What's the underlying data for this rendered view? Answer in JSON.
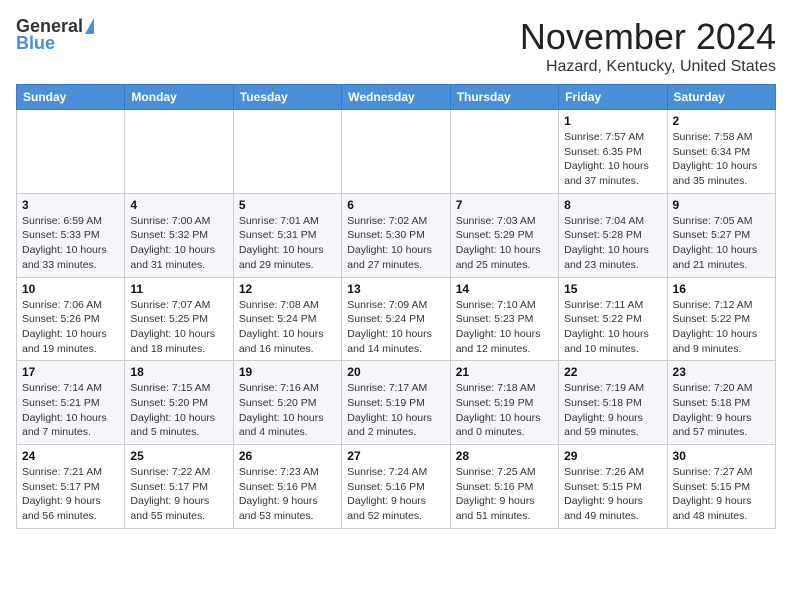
{
  "header": {
    "logo_general": "General",
    "logo_blue": "Blue",
    "month": "November 2024",
    "location": "Hazard, Kentucky, United States"
  },
  "weekdays": [
    "Sunday",
    "Monday",
    "Tuesday",
    "Wednesday",
    "Thursday",
    "Friday",
    "Saturday"
  ],
  "weeks": [
    [
      {
        "day": "",
        "sunrise": "",
        "sunset": "",
        "daylight": ""
      },
      {
        "day": "",
        "sunrise": "",
        "sunset": "",
        "daylight": ""
      },
      {
        "day": "",
        "sunrise": "",
        "sunset": "",
        "daylight": ""
      },
      {
        "day": "",
        "sunrise": "",
        "sunset": "",
        "daylight": ""
      },
      {
        "day": "",
        "sunrise": "",
        "sunset": "",
        "daylight": ""
      },
      {
        "day": "1",
        "sunrise": "Sunrise: 7:57 AM",
        "sunset": "Sunset: 6:35 PM",
        "daylight": "Daylight: 10 hours and 37 minutes."
      },
      {
        "day": "2",
        "sunrise": "Sunrise: 7:58 AM",
        "sunset": "Sunset: 6:34 PM",
        "daylight": "Daylight: 10 hours and 35 minutes."
      }
    ],
    [
      {
        "day": "3",
        "sunrise": "Sunrise: 6:59 AM",
        "sunset": "Sunset: 5:33 PM",
        "daylight": "Daylight: 10 hours and 33 minutes."
      },
      {
        "day": "4",
        "sunrise": "Sunrise: 7:00 AM",
        "sunset": "Sunset: 5:32 PM",
        "daylight": "Daylight: 10 hours and 31 minutes."
      },
      {
        "day": "5",
        "sunrise": "Sunrise: 7:01 AM",
        "sunset": "Sunset: 5:31 PM",
        "daylight": "Daylight: 10 hours and 29 minutes."
      },
      {
        "day": "6",
        "sunrise": "Sunrise: 7:02 AM",
        "sunset": "Sunset: 5:30 PM",
        "daylight": "Daylight: 10 hours and 27 minutes."
      },
      {
        "day": "7",
        "sunrise": "Sunrise: 7:03 AM",
        "sunset": "Sunset: 5:29 PM",
        "daylight": "Daylight: 10 hours and 25 minutes."
      },
      {
        "day": "8",
        "sunrise": "Sunrise: 7:04 AM",
        "sunset": "Sunset: 5:28 PM",
        "daylight": "Daylight: 10 hours and 23 minutes."
      },
      {
        "day": "9",
        "sunrise": "Sunrise: 7:05 AM",
        "sunset": "Sunset: 5:27 PM",
        "daylight": "Daylight: 10 hours and 21 minutes."
      }
    ],
    [
      {
        "day": "10",
        "sunrise": "Sunrise: 7:06 AM",
        "sunset": "Sunset: 5:26 PM",
        "daylight": "Daylight: 10 hours and 19 minutes."
      },
      {
        "day": "11",
        "sunrise": "Sunrise: 7:07 AM",
        "sunset": "Sunset: 5:25 PM",
        "daylight": "Daylight: 10 hours and 18 minutes."
      },
      {
        "day": "12",
        "sunrise": "Sunrise: 7:08 AM",
        "sunset": "Sunset: 5:24 PM",
        "daylight": "Daylight: 10 hours and 16 minutes."
      },
      {
        "day": "13",
        "sunrise": "Sunrise: 7:09 AM",
        "sunset": "Sunset: 5:24 PM",
        "daylight": "Daylight: 10 hours and 14 minutes."
      },
      {
        "day": "14",
        "sunrise": "Sunrise: 7:10 AM",
        "sunset": "Sunset: 5:23 PM",
        "daylight": "Daylight: 10 hours and 12 minutes."
      },
      {
        "day": "15",
        "sunrise": "Sunrise: 7:11 AM",
        "sunset": "Sunset: 5:22 PM",
        "daylight": "Daylight: 10 hours and 10 minutes."
      },
      {
        "day": "16",
        "sunrise": "Sunrise: 7:12 AM",
        "sunset": "Sunset: 5:22 PM",
        "daylight": "Daylight: 10 hours and 9 minutes."
      }
    ],
    [
      {
        "day": "17",
        "sunrise": "Sunrise: 7:14 AM",
        "sunset": "Sunset: 5:21 PM",
        "daylight": "Daylight: 10 hours and 7 minutes."
      },
      {
        "day": "18",
        "sunrise": "Sunrise: 7:15 AM",
        "sunset": "Sunset: 5:20 PM",
        "daylight": "Daylight: 10 hours and 5 minutes."
      },
      {
        "day": "19",
        "sunrise": "Sunrise: 7:16 AM",
        "sunset": "Sunset: 5:20 PM",
        "daylight": "Daylight: 10 hours and 4 minutes."
      },
      {
        "day": "20",
        "sunrise": "Sunrise: 7:17 AM",
        "sunset": "Sunset: 5:19 PM",
        "daylight": "Daylight: 10 hours and 2 minutes."
      },
      {
        "day": "21",
        "sunrise": "Sunrise: 7:18 AM",
        "sunset": "Sunset: 5:19 PM",
        "daylight": "Daylight: 10 hours and 0 minutes."
      },
      {
        "day": "22",
        "sunrise": "Sunrise: 7:19 AM",
        "sunset": "Sunset: 5:18 PM",
        "daylight": "Daylight: 9 hours and 59 minutes."
      },
      {
        "day": "23",
        "sunrise": "Sunrise: 7:20 AM",
        "sunset": "Sunset: 5:18 PM",
        "daylight": "Daylight: 9 hours and 57 minutes."
      }
    ],
    [
      {
        "day": "24",
        "sunrise": "Sunrise: 7:21 AM",
        "sunset": "Sunset: 5:17 PM",
        "daylight": "Daylight: 9 hours and 56 minutes."
      },
      {
        "day": "25",
        "sunrise": "Sunrise: 7:22 AM",
        "sunset": "Sunset: 5:17 PM",
        "daylight": "Daylight: 9 hours and 55 minutes."
      },
      {
        "day": "26",
        "sunrise": "Sunrise: 7:23 AM",
        "sunset": "Sunset: 5:16 PM",
        "daylight": "Daylight: 9 hours and 53 minutes."
      },
      {
        "day": "27",
        "sunrise": "Sunrise: 7:24 AM",
        "sunset": "Sunset: 5:16 PM",
        "daylight": "Daylight: 9 hours and 52 minutes."
      },
      {
        "day": "28",
        "sunrise": "Sunrise: 7:25 AM",
        "sunset": "Sunset: 5:16 PM",
        "daylight": "Daylight: 9 hours and 51 minutes."
      },
      {
        "day": "29",
        "sunrise": "Sunrise: 7:26 AM",
        "sunset": "Sunset: 5:15 PM",
        "daylight": "Daylight: 9 hours and 49 minutes."
      },
      {
        "day": "30",
        "sunrise": "Sunrise: 7:27 AM",
        "sunset": "Sunset: 5:15 PM",
        "daylight": "Daylight: 9 hours and 48 minutes."
      }
    ]
  ]
}
